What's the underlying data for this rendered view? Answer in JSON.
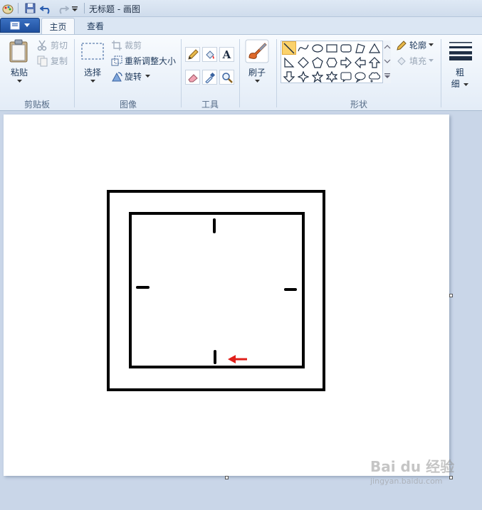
{
  "window": {
    "title": "无标题 - 画图"
  },
  "tabs": [
    {
      "label": "主页",
      "active": true
    },
    {
      "label": "查看",
      "active": false
    }
  ],
  "ribbon": {
    "clipboard": {
      "paste": "粘贴",
      "cut": "剪切",
      "copy": "复制",
      "group_label": "剪贴板"
    },
    "image": {
      "select": "选择",
      "crop": "裁剪",
      "resize": "重新调整大小",
      "rotate": "旋转",
      "group_label": "图像"
    },
    "tools": {
      "group_label": "工具",
      "text_glyph": "A"
    },
    "brushes": {
      "label": "刷子"
    },
    "shapes": {
      "group_label": "形状",
      "outline": "轮廓",
      "fill": "填充"
    },
    "size": {
      "label_line1": "粗",
      "label_line2": "细"
    }
  },
  "watermark": {
    "logo": "Bai du 经验",
    "sub": "jingyan.baidu.com"
  },
  "colors": {
    "accent": "#2b5fb3",
    "selected_shape": "#fbd26b",
    "arrow_red": "#e0201b"
  }
}
